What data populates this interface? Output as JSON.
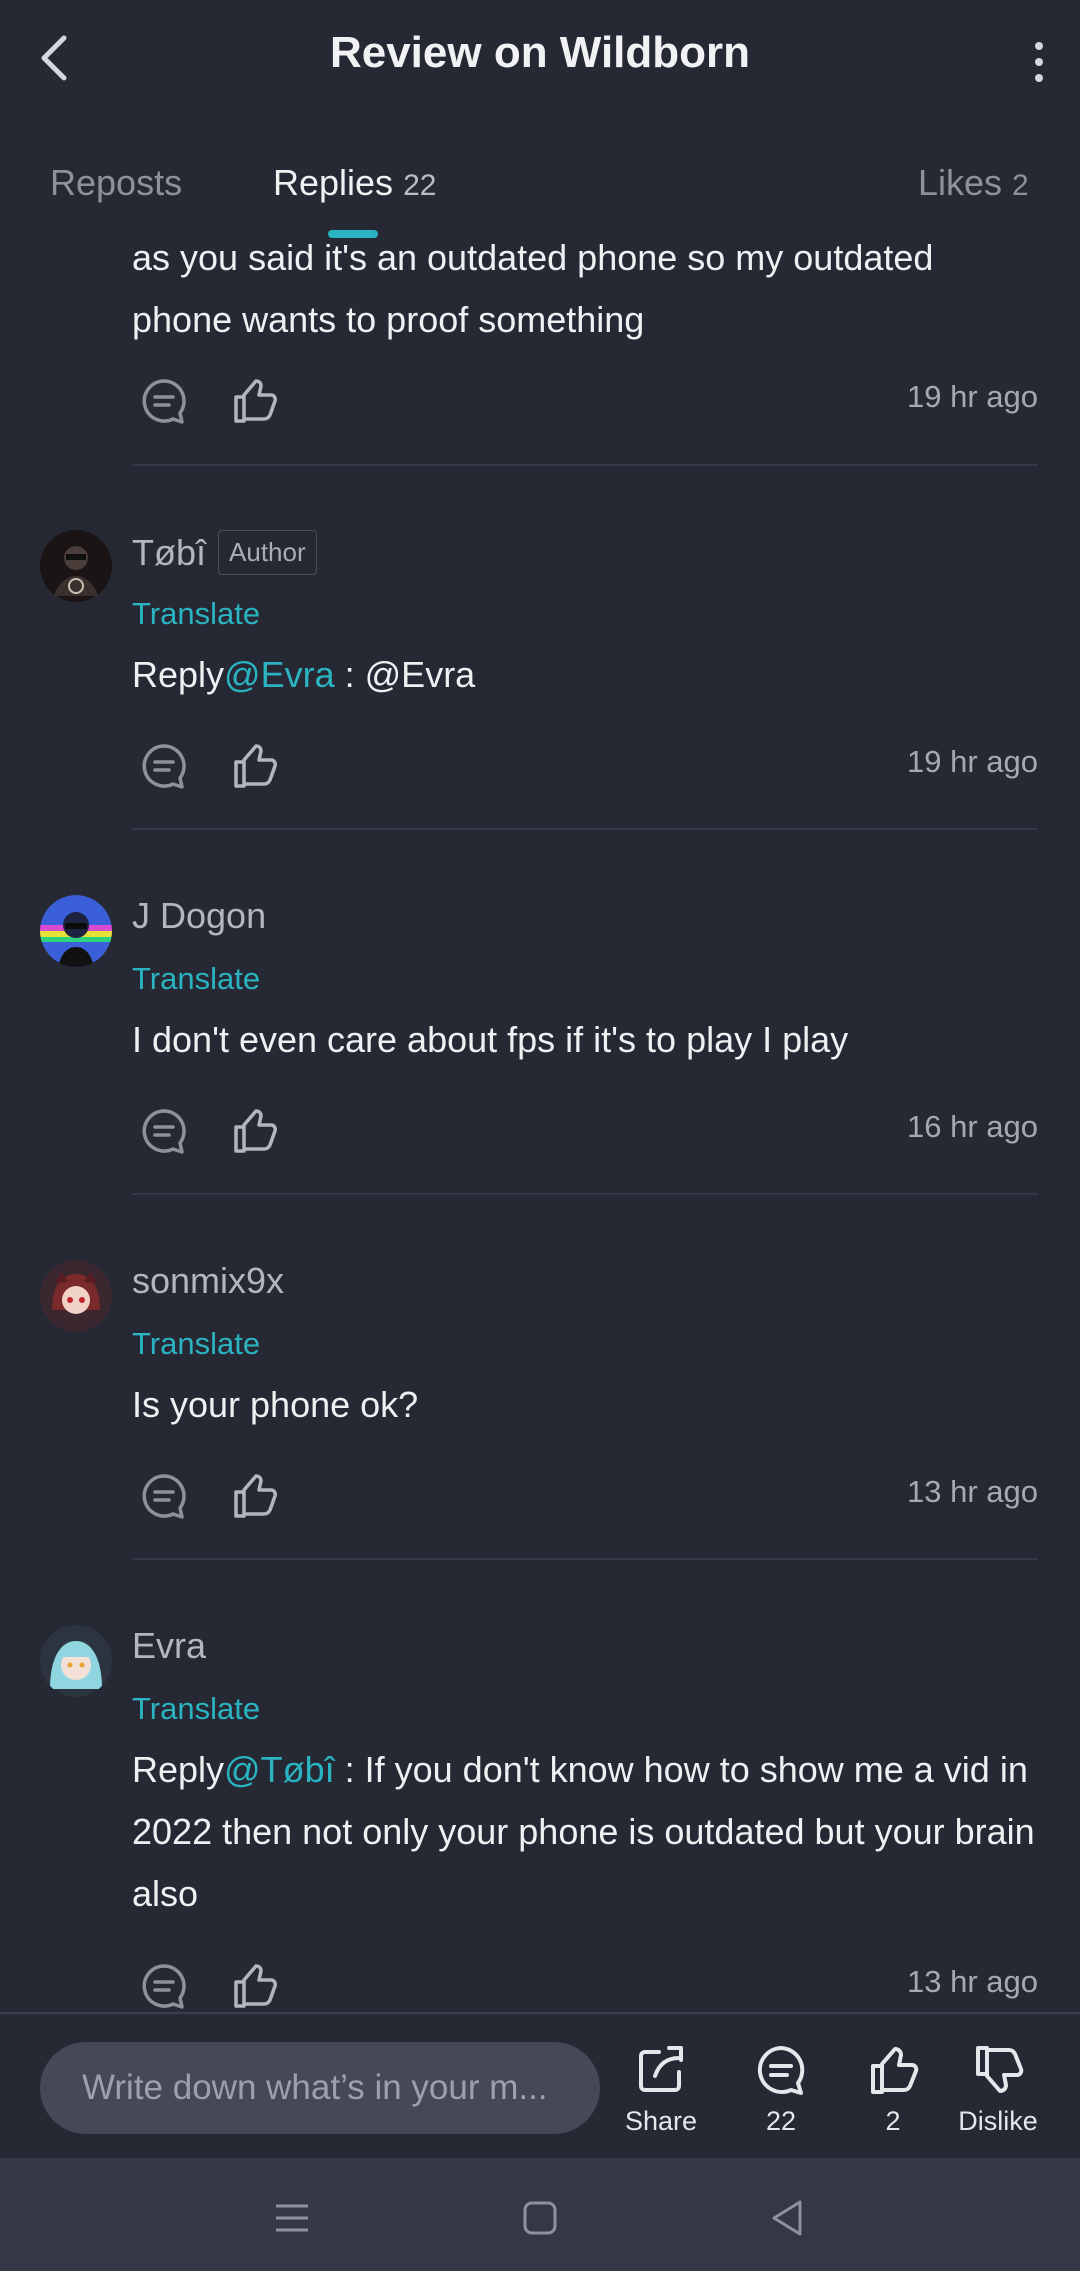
{
  "header": {
    "title": "Review on Wildborn"
  },
  "tabs": [
    {
      "label": "Reposts",
      "count": ""
    },
    {
      "label": "Replies",
      "count": "22"
    },
    {
      "label": "Likes",
      "count": "2"
    }
  ],
  "replies": [
    {
      "text_lines": [
        "as you said it's an outdated phone so my outdated",
        "phone wants to proof something"
      ],
      "time": "19 hr ago"
    },
    {
      "user": "Tøbî",
      "badge": "Author",
      "translate": "Translate",
      "reply_prefix": "Reply",
      "mention": "@Evra",
      "text": " : @Evra",
      "time": "19 hr ago"
    },
    {
      "user": "J Dogon",
      "translate": "Translate",
      "text": "I don't even care about fps if it's to play I play",
      "time": "16 hr ago"
    },
    {
      "user": "sonmix9x",
      "translate": "Translate",
      "text": "Is your phone ok?",
      "time": "13 hr ago"
    },
    {
      "user": "Evra",
      "translate": "Translate",
      "reply_prefix": "Reply",
      "mention": "@Tøbî",
      "text_line1": " : If you don't know how to show me a vid in",
      "text_line2": "2022 then not only your phone is outdated but your brain",
      "text_line3": "also",
      "time": "13 hr ago"
    }
  ],
  "bottom_bar": {
    "input_placeholder": "Write down what’s in your m...",
    "share_label": "Share",
    "comments_count": "22",
    "likes_count": "2",
    "dislike_label": "Dislike"
  },
  "icons": [
    "back-icon",
    "more-vertical-icon",
    "comment-icon",
    "thumbs-up-icon",
    "share-icon",
    "thumbs-down-icon",
    "menu-icon",
    "home-square-icon",
    "back-triangle-icon"
  ],
  "colors": {
    "background": "#262833",
    "accent": "#2ab3c0",
    "navbar": "#343746"
  }
}
